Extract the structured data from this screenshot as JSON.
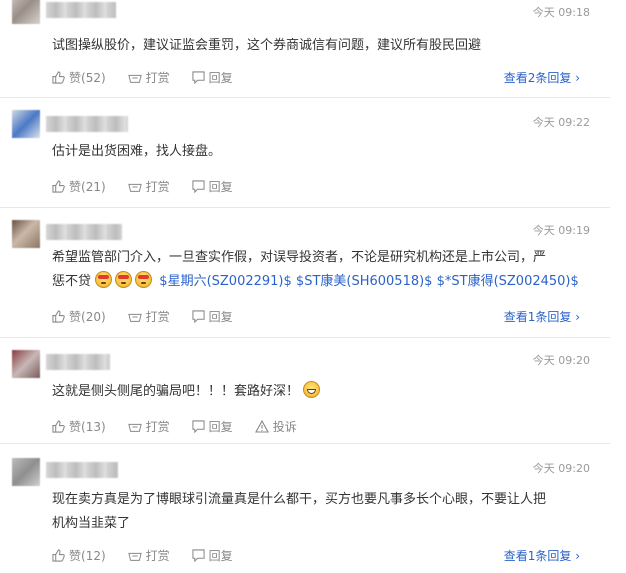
{
  "actions": {
    "like_label": "赞",
    "reward_label": "打赏",
    "reply_label": "回复",
    "report_label": "投诉"
  },
  "comments": [
    {
      "time": "今天 09:18",
      "text": "试图操纵股价，建议证监会重罚，这个券商诚信有问题，建议所有股民回避",
      "likes": "(52)",
      "view_replies": "查看2条回复 ›"
    },
    {
      "time": "今天 09:22",
      "text": "估计是出货困难，找人接盘。",
      "likes": "(21)"
    },
    {
      "time": "今天 09:19",
      "text_line1": "希望监管部门介入，一旦查实作假，对误导投资者，不论是研究机构还是上市公司，严",
      "text_line2": "惩不贷",
      "stock1": "$星期六(SZ002291)$",
      "stock2": "$ST康美(SH600518)$",
      "stock3": "$*ST康得(SZ002450)$",
      "likes": "(20)",
      "view_replies": "查看1条回复 ›"
    },
    {
      "time": "今天 09:20",
      "text": "这就是侧头侧尾的骗局吧！！！套路好深！",
      "likes": "(13)"
    },
    {
      "time": "今天 09:20",
      "text_line1": "现在卖方真是为了博眼球引流量真是什么都干，买方也要凡事多长个心眼，不要让人把",
      "text_line2": "机构当韭菜了",
      "likes": "(12)",
      "view_replies": "查看1条回复 ›"
    }
  ]
}
